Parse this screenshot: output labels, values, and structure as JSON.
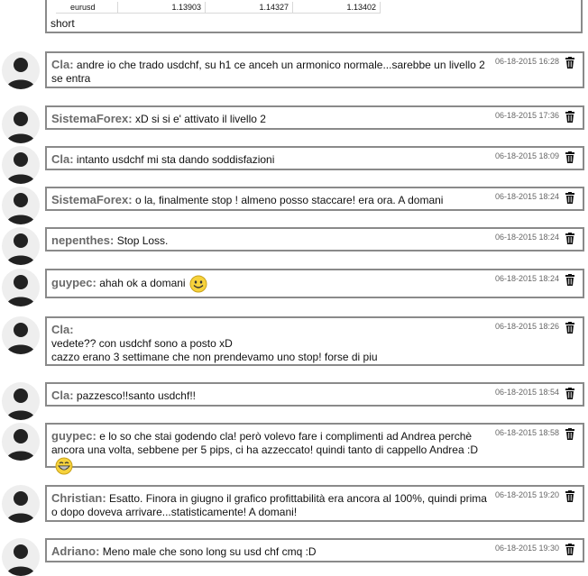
{
  "top": {
    "table": [
      {
        "symbol": "eurusd",
        "values": [
          "1.13903",
          "1.14327",
          "1.13402"
        ]
      }
    ],
    "text": "short"
  },
  "messages": [
    {
      "user": "Cla:",
      "text": "andre io che trado usdchf, su h1 ce anceh un armonico normale...sarebbe un livello 2 se entra",
      "time": "06-18-2015 16:28"
    },
    {
      "user": "SistemaForex:",
      "text": "xD si si e' attivato il livello 2",
      "time": "06-18-2015 17:36"
    },
    {
      "user": "Cla:",
      "text": "intanto usdchf mi sta dando soddisfazioni",
      "time": "06-18-2015 18:09"
    },
    {
      "user": "SistemaForex:",
      "text": "o la, finalmente stop ! almeno posso staccare! era ora. A domani",
      "time": "06-18-2015 18:24"
    },
    {
      "user": "nepenthes:",
      "text": "Stop Loss.",
      "time": "06-18-2015 18:24"
    },
    {
      "user": "guypec:",
      "text": "ahah ok a domani",
      "time": "06-18-2015 18:24",
      "emoji": "smile"
    },
    {
      "user": "Cla:",
      "line1": "vedete?? con usdchf sono a posto xD",
      "line2": "cazzo erano 3 settimane che non prendevamo uno stop! forse di piu",
      "time": "06-18-2015 18:26"
    },
    {
      "user": "Cla:",
      "text": "pazzesco!!santo usdchf!!",
      "time": "06-18-2015 18:54"
    },
    {
      "user": "guypec:",
      "text": "e lo so che stai godendo cla! però volevo fare i complimenti ad Andrea perchè ancora una volta, sebbene per 5 pips, ci ha azzeccato! quindi tanto di cappello Andrea :D",
      "time": "06-18-2015 18:58",
      "emoji": "grin"
    },
    {
      "user": "Christian:",
      "text": "Esatto. Finora in giugno il grafico profittabilità era ancora al 100%, quindi prima o dopo doveva arrivare...statisticamente! A domani!",
      "time": "06-18-2015 19:20"
    },
    {
      "user": "Adriano:",
      "text": "Meno male che sono long su usd chf cmq :D",
      "time": "06-18-2015 19:30"
    }
  ]
}
